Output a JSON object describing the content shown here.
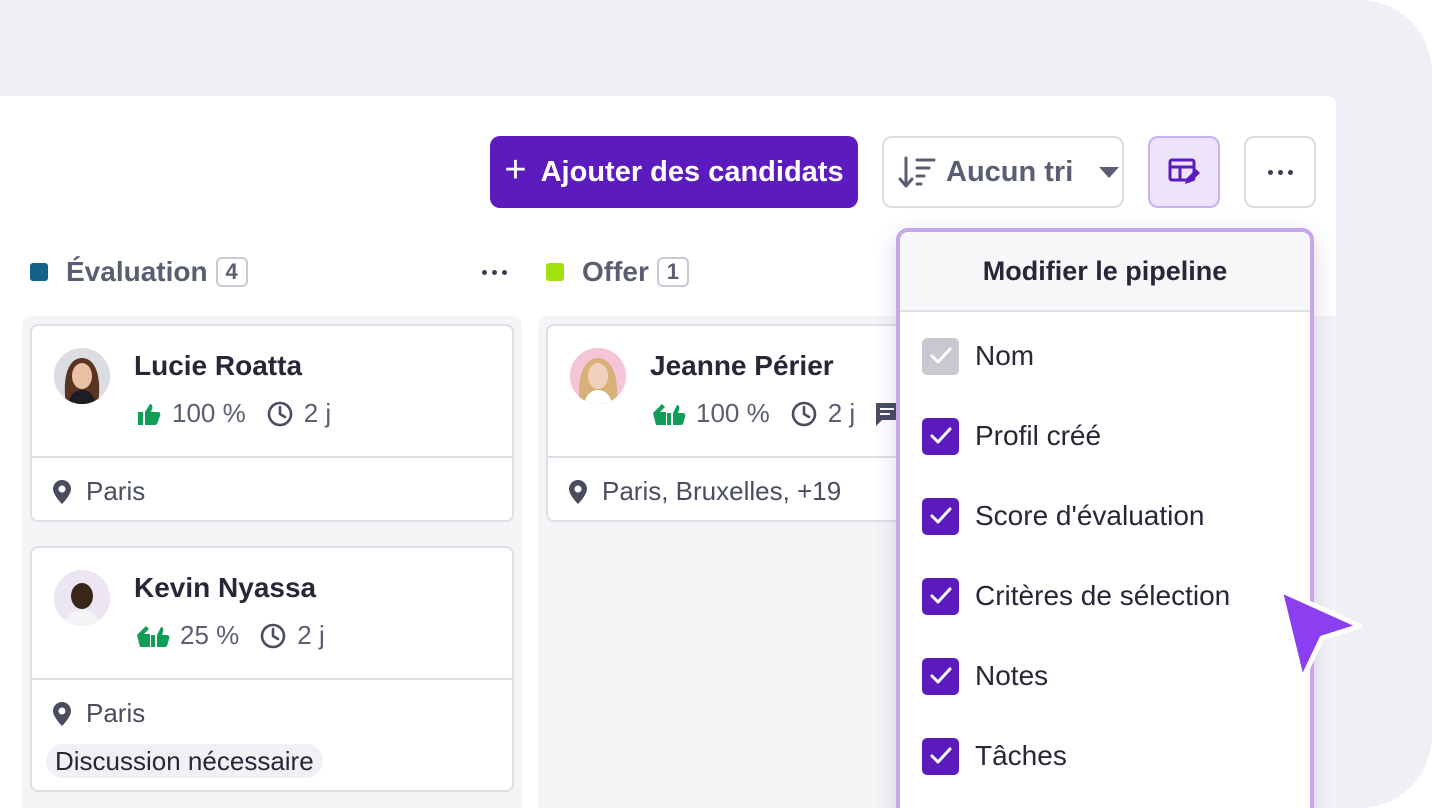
{
  "toolbar": {
    "add_label": "Ajouter des candidats",
    "sort_label": "Aucun tri"
  },
  "columns": [
    {
      "title": "Évaluation",
      "count": "4",
      "color": "#12628a"
    },
    {
      "title": "Offer",
      "count": "1",
      "color": "#a3e00d"
    }
  ],
  "cards": [
    {
      "name": "Lucie Roatta",
      "score": "100 %",
      "time": "2 j",
      "location": "Paris"
    },
    {
      "name": "Kevin Nyassa",
      "score": "25 %",
      "time": "2 j",
      "location": "Paris",
      "tag": "Discussion nécessaire"
    },
    {
      "name": "Jeanne Périer",
      "score": "100 %",
      "time": "2 j",
      "location": "Paris, Bruxelles, +19"
    }
  ],
  "dropdown": {
    "title": "Modifier le pipeline",
    "items": [
      {
        "label": "Nom",
        "checked": true,
        "disabled": true
      },
      {
        "label": "Profil créé",
        "checked": true
      },
      {
        "label": "Score d'évaluation",
        "checked": true
      },
      {
        "label": "Critères de sélection",
        "checked": true
      },
      {
        "label": "Notes",
        "checked": true
      },
      {
        "label": "Tâches",
        "checked": true
      }
    ]
  },
  "colors": {
    "accent": "#5b1bbd",
    "green": "#0f9d58",
    "cursor": "#8b3ff0"
  },
  "icons": [
    "plus-icon",
    "sort-icon",
    "table-edit-icon",
    "more-icon",
    "thumbs-up-icon",
    "clock-icon",
    "location-pin-icon",
    "comment-icon",
    "check-icon",
    "cursor-arrow-icon"
  ]
}
